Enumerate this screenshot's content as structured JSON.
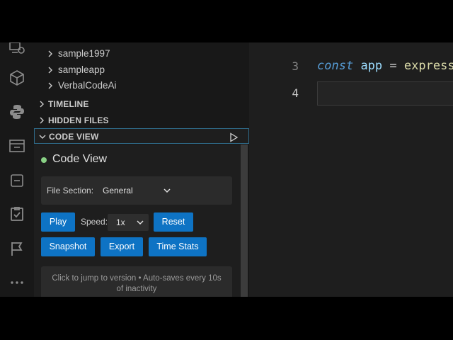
{
  "sidebar": {
    "folders": [
      {
        "label": "sample1997"
      },
      {
        "label": "sampleapp"
      },
      {
        "label": "VerbalCodeAi"
      }
    ],
    "sections": {
      "timeline": "TIMELINE",
      "hidden_files": "HIDDEN FILES",
      "code_view": "CODE VIEW"
    }
  },
  "code_view_panel": {
    "title": "Code View",
    "file_section_label": "File Section:",
    "file_section_value": "General",
    "play_label": "Play",
    "speed_label": "Speed:",
    "speed_value": "1x",
    "reset_label": "Reset",
    "snapshot_label": "Snapshot",
    "export_label": "Export",
    "time_stats_label": "Time Stats",
    "hint": "Click to jump to version • Auto-saves every 10s of inactivity"
  },
  "editor": {
    "line_numbers": [
      "3",
      "4"
    ],
    "line3": {
      "kw": "const",
      "id": "app",
      "op": "=",
      "fn": "express"
    }
  },
  "colors": {
    "accent_button": "#0e73c4",
    "status_dot": "#89d185",
    "keyword": "#569cd6"
  }
}
